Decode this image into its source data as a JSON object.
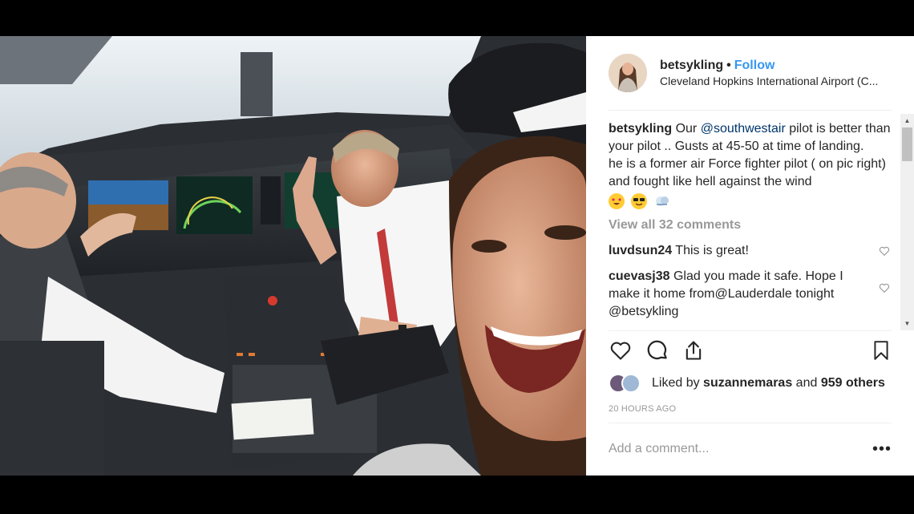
{
  "post": {
    "username": "betsykling",
    "separator": "•",
    "follow_label": "Follow",
    "location": "Cleveland Hopkins International Airport (C...",
    "caption": {
      "username": "betsykling",
      "text_before_mention": " Our ",
      "mention": "@southwestair",
      "text_after_mention": " pilot is better than your pilot .. Gusts at 45-50 at time of landing.",
      "line2": "he is a former air Force fighter pilot ( on pic right) and fought like hell against the wind",
      "emojis": [
        "heart-eyes-emoji",
        "sunglasses-emoji",
        "wind-emoji"
      ]
    },
    "view_all_label": "View all 32 comments",
    "comments": [
      {
        "username": "luvdsun24",
        "text": "This is great!"
      },
      {
        "username": "cuevasj38",
        "text": "Glad you made it safe. Hope I make it home from@Lauderdale tonight @betsykling"
      }
    ],
    "likes": {
      "prefix": "Liked by ",
      "user": "suzannemaras",
      "middle": " and ",
      "others": "959 others"
    },
    "timestamp": "20 HOURS AGO",
    "add_comment_placeholder": "Add a comment...",
    "more_options": "•••"
  },
  "icons": {
    "like": "heart-icon",
    "comment": "comment-icon",
    "share": "share-icon",
    "save": "bookmark-icon"
  },
  "colors": {
    "follow": "#3897f0",
    "mention": "#003569",
    "muted": "#999999",
    "text": "#262626"
  }
}
